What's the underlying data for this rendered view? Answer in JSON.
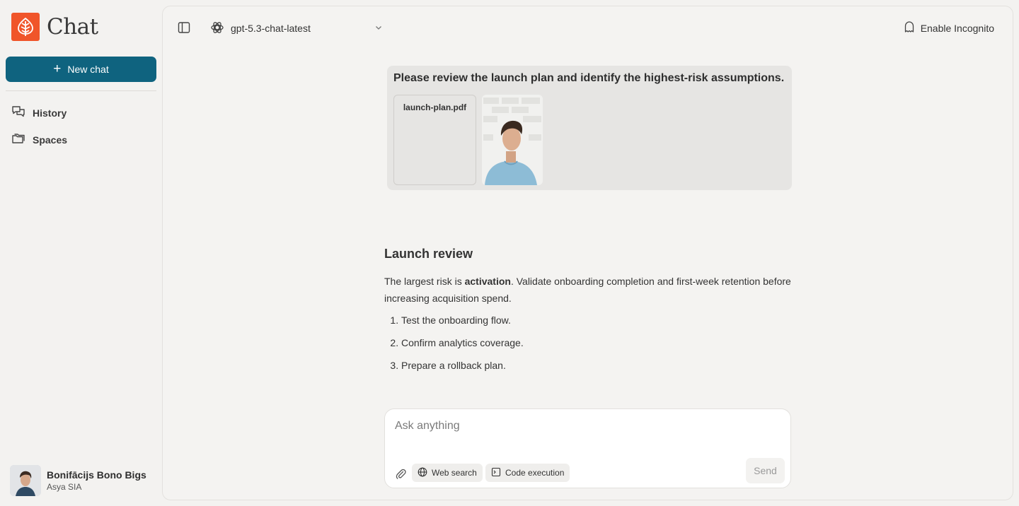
{
  "brand": {
    "name": "Chat",
    "logo_icon": "leaf-icon",
    "logo_color": "#f0552a"
  },
  "sidebar": {
    "new_chat_label": "New chat",
    "items": [
      {
        "label": "History",
        "icon": "chat-bubbles-icon"
      },
      {
        "label": "Spaces",
        "icon": "folders-icon"
      }
    ]
  },
  "user": {
    "name": "Bonifācijs Bono Bigs",
    "org": "Asya SIA"
  },
  "topbar": {
    "model": "gpt-5.3-chat-latest",
    "incognito_label": "Enable Incognito"
  },
  "conversation": {
    "user_message": "Please review the launch plan and identify the highest-risk assumptions.",
    "attachments": {
      "file_name": "launch-plan.pdf"
    },
    "reply": {
      "title": "Launch review",
      "p_before": "The largest risk is ",
      "p_bold": "activation",
      "p_after": ". Validate onboarding completion and first-week retention before increasing acquisition spend.",
      "steps": [
        "Test the onboarding flow.",
        "Confirm analytics coverage.",
        "Prepare a rollback plan."
      ]
    }
  },
  "composer": {
    "placeholder": "Ask anything",
    "tools": [
      "Web search",
      "Code execution"
    ],
    "send_label": "Send"
  },
  "colors": {
    "accent": "#0f637f",
    "background": "#f3f2f0"
  }
}
